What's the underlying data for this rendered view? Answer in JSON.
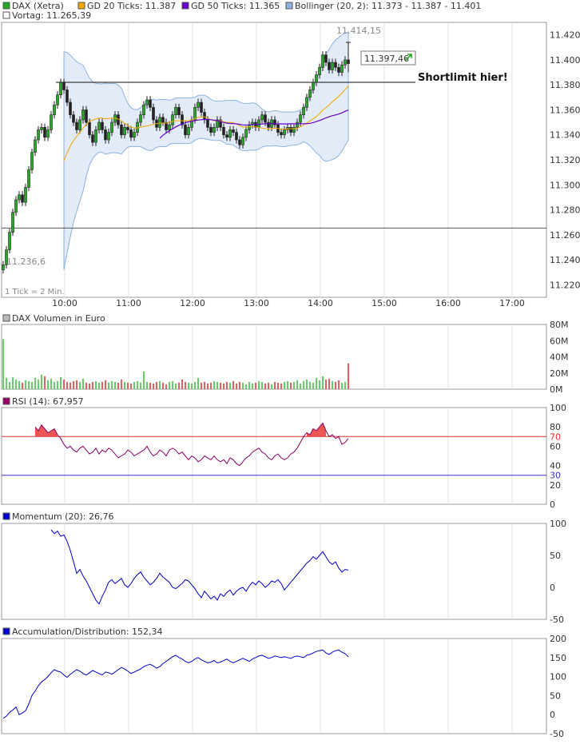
{
  "chart_data": [
    {
      "type": "candlestick",
      "id": "price",
      "legend": [
        {
          "label": "DAX (Xetra)",
          "color": "#22aa22"
        },
        {
          "label": "GD 20 Ticks: 11.387",
          "color": "#f0a800"
        },
        {
          "label": "GD 50 Ticks: 11.365",
          "color": "#6600cc"
        },
        {
          "label": "Bollinger (20, 2): 11.373 - 11.387 - 11.401",
          "color": "#8fb2e0"
        },
        {
          "label": "Vortag: 11.265,39",
          "color": "#ffffff"
        }
      ],
      "ylim": [
        11210,
        11430
      ],
      "yticks": [
        11220,
        11240,
        11260,
        11280,
        11300,
        11320,
        11340,
        11360,
        11380,
        11400,
        11420
      ],
      "ytick_labels": [
        "11.220",
        "11.240",
        "11.260",
        "11.280",
        "11.300",
        "11.320",
        "11.340",
        "11.360",
        "11.380",
        "11.400",
        "11.420"
      ],
      "xticks": [
        "10:00",
        "11:00",
        "12:00",
        "13:00",
        "14:00",
        "15:00",
        "16:00",
        "17:00"
      ],
      "previous_close": 11265.39,
      "tick_note": "1 Tick = 2 Min.",
      "low_label": "11.236,6",
      "high_label": "11.414,15",
      "last_label": "11.397,46",
      "annotation": "Shortlimit hier!",
      "shortlimit_level": 11382,
      "close_series": [
        11236,
        11248,
        11262,
        11278,
        11288,
        11292,
        11286,
        11298,
        11312,
        11326,
        11336,
        11344,
        11346,
        11338,
        11344,
        11356,
        11364,
        11372,
        11382,
        11376,
        11366,
        11356,
        11350,
        11344,
        11352,
        11360,
        11350,
        11340,
        11334,
        11344,
        11350,
        11344,
        11336,
        11342,
        11350,
        11356,
        11348,
        11340,
        11346,
        11344,
        11338,
        11342,
        11350,
        11356,
        11364,
        11368,
        11362,
        11352,
        11346,
        11354,
        11350,
        11344,
        11348,
        11356,
        11362,
        11356,
        11348,
        11340,
        11346,
        11352,
        11362,
        11366,
        11358,
        11352,
        11346,
        11342,
        11346,
        11352,
        11346,
        11340,
        11338,
        11344,
        11342,
        11336,
        11332,
        11338,
        11344,
        11348,
        11350,
        11346,
        11352,
        11356,
        11350,
        11346,
        11352,
        11348,
        11342,
        11340,
        11344,
        11346,
        11342,
        11346,
        11350,
        11356,
        11362,
        11370,
        11376,
        11382,
        11388,
        11394,
        11404,
        11398,
        11392,
        11398,
        11394,
        11390,
        11396,
        11400,
        11397
      ]
    },
    {
      "type": "bar",
      "id": "volume",
      "title": "DAX Volumen in Euro",
      "ylim": [
        0,
        80
      ],
      "yticks": [
        0,
        20,
        40,
        60,
        80
      ],
      "ytick_labels": [
        "0M",
        "20M",
        "40M",
        "60M",
        "80M"
      ],
      "values": [
        62,
        14,
        9,
        15,
        12,
        10,
        8,
        11,
        10,
        9,
        14,
        12,
        18,
        16,
        11,
        13,
        9,
        10,
        15,
        12,
        9,
        8,
        10,
        11,
        9,
        13,
        8,
        7,
        9,
        10,
        8,
        9,
        11,
        8,
        10,
        9,
        8,
        12,
        9,
        8,
        7,
        9,
        10,
        8,
        22,
        9,
        8,
        7,
        9,
        10,
        8,
        6,
        9,
        10,
        7,
        8,
        12,
        9,
        8,
        7,
        9,
        14,
        8,
        9,
        7,
        8,
        10,
        9,
        8,
        7,
        9,
        8,
        10,
        7,
        9,
        8,
        6,
        9,
        7,
        8,
        10,
        9,
        7,
        8,
        6,
        9,
        8,
        7,
        9,
        10,
        8,
        9,
        11,
        7,
        10,
        12,
        9,
        8,
        14,
        11,
        16,
        12,
        13,
        10,
        9,
        11,
        8,
        9,
        32
      ],
      "up_color": "#66cc66",
      "down_color": "#e06060"
    },
    {
      "type": "line",
      "id": "rsi",
      "title": "RSI (14): 67,957",
      "ylim": [
        0,
        100
      ],
      "yticks": [
        0,
        20,
        40,
        60,
        80,
        100
      ],
      "ytick_labels": [
        "0",
        "20",
        "40",
        "60",
        "80",
        "100"
      ],
      "upper_level": 70,
      "lower_level": 30,
      "upper_label": "70",
      "lower_label": "30",
      "values": [
        null,
        null,
        null,
        null,
        null,
        null,
        null,
        null,
        null,
        null,
        80,
        76,
        82,
        78,
        74,
        76,
        78,
        72,
        68,
        62,
        58,
        60,
        56,
        54,
        58,
        60,
        56,
        52,
        54,
        58,
        52,
        56,
        54,
        58,
        56,
        52,
        48,
        50,
        52,
        56,
        54,
        50,
        52,
        54,
        56,
        60,
        54,
        50,
        52,
        56,
        54,
        50,
        56,
        58,
        56,
        52,
        54,
        50,
        46,
        50,
        48,
        44,
        46,
        50,
        48,
        46,
        50,
        46,
        44,
        46,
        42,
        48,
        46,
        42,
        40,
        44,
        48,
        50,
        54,
        56,
        58,
        54,
        52,
        48,
        46,
        50,
        52,
        48,
        46,
        48,
        52,
        54,
        58,
        64,
        70,
        74,
        72,
        78,
        76,
        80,
        84,
        76,
        70,
        72,
        68,
        70,
        62,
        64,
        68
      ]
    },
    {
      "type": "line",
      "id": "momentum",
      "title": "Momentum (20): 26,76",
      "ylim": [
        -50,
        100
      ],
      "yticks": [
        -50,
        0,
        50,
        100
      ],
      "ytick_labels": [
        "-50",
        "0",
        "50",
        "100"
      ],
      "values": [
        null,
        null,
        null,
        null,
        null,
        null,
        null,
        null,
        null,
        null,
        null,
        null,
        null,
        null,
        null,
        90,
        84,
        88,
        80,
        82,
        72,
        58,
        40,
        22,
        28,
        18,
        10,
        0,
        -10,
        -20,
        -26,
        -14,
        -4,
        8,
        12,
        6,
        10,
        14,
        4,
        0,
        6,
        14,
        20,
        24,
        16,
        10,
        4,
        8,
        14,
        22,
        16,
        12,
        8,
        0,
        -2,
        2,
        6,
        12,
        10,
        4,
        -2,
        -10,
        -16,
        -6,
        -12,
        -18,
        -14,
        -20,
        -10,
        -14,
        -8,
        -4,
        -12,
        -6,
        -2,
        0,
        -6,
        2,
        8,
        4,
        10,
        6,
        0,
        4,
        10,
        8,
        12,
        6,
        -4,
        2,
        8,
        14,
        20,
        26,
        32,
        38,
        42,
        48,
        44,
        50,
        56,
        48,
        40,
        36,
        40,
        30,
        24,
        28,
        27
      ]
    },
    {
      "type": "line",
      "id": "accdist",
      "title": "Accumulation/Distribution: 152,34",
      "ylim": [
        -50,
        200
      ],
      "yticks": [
        -50,
        0,
        50,
        100,
        150,
        200
      ],
      "ytick_labels": [
        "-50",
        "0",
        "50",
        "100",
        "150",
        "200"
      ],
      "values": [
        -10,
        -4,
        6,
        12,
        20,
        0,
        4,
        10,
        28,
        50,
        62,
        76,
        86,
        92,
        100,
        110,
        118,
        114,
        112,
        104,
        98,
        106,
        112,
        118,
        114,
        108,
        104,
        110,
        116,
        112,
        108,
        104,
        112,
        110,
        106,
        112,
        118,
        124,
        120,
        114,
        108,
        112,
        116,
        120,
        126,
        130,
        132,
        128,
        122,
        126,
        134,
        140,
        146,
        152,
        156,
        150,
        146,
        140,
        136,
        140,
        146,
        150,
        144,
        140,
        136,
        138,
        142,
        136,
        138,
        142,
        146,
        140,
        136,
        140,
        144,
        148,
        144,
        140,
        146,
        150,
        154,
        156,
        152,
        148,
        150,
        154,
        152,
        150,
        152,
        150,
        148,
        152,
        154,
        152,
        150,
        156,
        158,
        162,
        166,
        168,
        170,
        162,
        158,
        164,
        168,
        170,
        164,
        160,
        152
      ]
    }
  ]
}
